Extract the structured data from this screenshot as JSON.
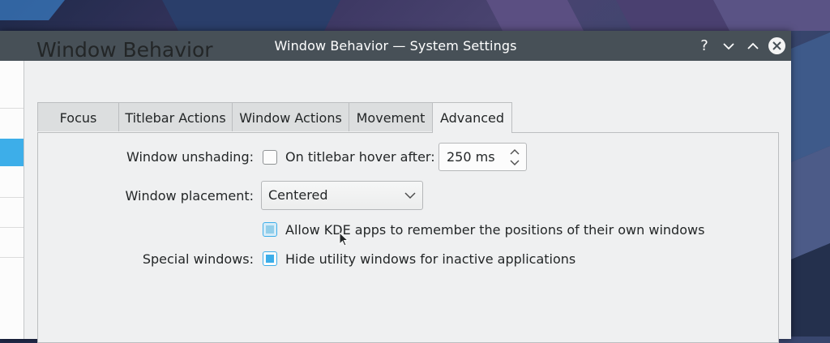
{
  "window": {
    "title": "Window Behavior — System Settings",
    "help_label": "?",
    "minimize_label": "⌄",
    "maximize_label": "⌃"
  },
  "page_title": "Window Behavior",
  "tabs": [
    {
      "label": "Focus",
      "active": false
    },
    {
      "label": "Titlebar Actions",
      "active": false
    },
    {
      "label": "Window Actions",
      "active": false
    },
    {
      "label": "Movement",
      "active": false
    },
    {
      "label": "Advanced",
      "active": true
    }
  ],
  "advanced": {
    "unshading_label": "Window unshading:",
    "unshading_checkbox_label": "On titlebar hover after:",
    "unshading_checked": false,
    "unshading_delay": "250 ms",
    "placement_label": "Window placement:",
    "placement_value": "Centered",
    "remember_label": "Allow KDE apps to remember the positions of their own windows",
    "remember_checked": true,
    "special_label": "Special windows:",
    "hide_utility_label": "Hide utility windows for inactive applications",
    "hide_utility_checked": true
  },
  "colors": {
    "accent": "#3daee9",
    "titlebar": "#475057",
    "window_bg": "#eff0f1"
  }
}
